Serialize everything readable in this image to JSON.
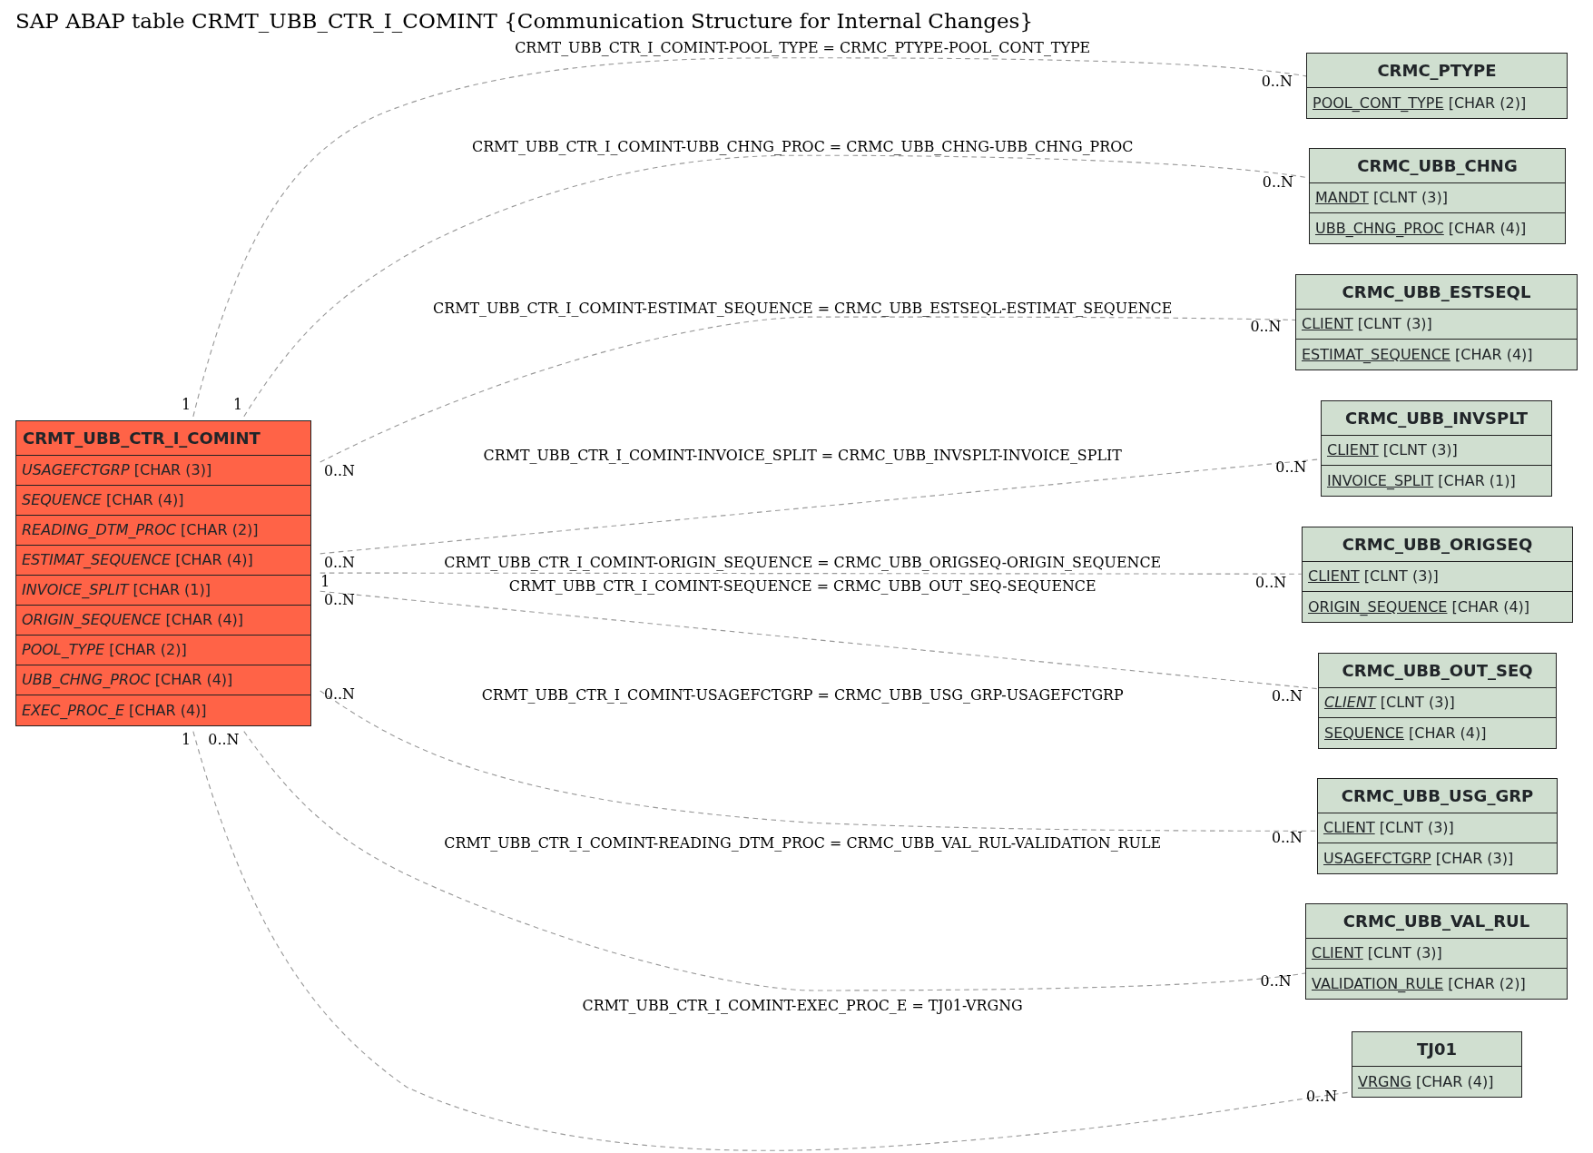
{
  "title": "SAP ABAP table CRMT_UBB_CTR_I_COMINT {Communication Structure for Internal Changes}",
  "main_table": {
    "name": "CRMT_UBB_CTR_I_COMINT",
    "fields": [
      {
        "name": "USAGEFCTGRP",
        "type": "[CHAR (3)]",
        "key": false,
        "italic": true
      },
      {
        "name": "SEQUENCE",
        "type": "[CHAR (4)]",
        "key": false,
        "italic": true
      },
      {
        "name": "READING_DTM_PROC",
        "type": "[CHAR (2)]",
        "key": false,
        "italic": true
      },
      {
        "name": "ESTIMAT_SEQUENCE",
        "type": "[CHAR (4)]",
        "key": false,
        "italic": true
      },
      {
        "name": "INVOICE_SPLIT",
        "type": "[CHAR (1)]",
        "key": false,
        "italic": true
      },
      {
        "name": "ORIGIN_SEQUENCE",
        "type": "[CHAR (4)]",
        "key": false,
        "italic": true
      },
      {
        "name": "POOL_TYPE",
        "type": "[CHAR (2)]",
        "key": false,
        "italic": true
      },
      {
        "name": "UBB_CHNG_PROC",
        "type": "[CHAR (4)]",
        "key": false,
        "italic": true
      },
      {
        "name": "EXEC_PROC_E",
        "type": "[CHAR (4)]",
        "key": false,
        "italic": true
      }
    ]
  },
  "related_tables": [
    {
      "name": "CRMC_PTYPE",
      "fields": [
        {
          "name": "POOL_CONT_TYPE",
          "type": "[CHAR (2)]",
          "key": true,
          "italic": false
        }
      ]
    },
    {
      "name": "CRMC_UBB_CHNG",
      "fields": [
        {
          "name": "MANDT",
          "type": "[CLNT (3)]",
          "key": true,
          "italic": false
        },
        {
          "name": "UBB_CHNG_PROC",
          "type": "[CHAR (4)]",
          "key": true,
          "italic": false
        }
      ]
    },
    {
      "name": "CRMC_UBB_ESTSEQL",
      "fields": [
        {
          "name": "CLIENT",
          "type": "[CLNT (3)]",
          "key": true,
          "italic": false
        },
        {
          "name": "ESTIMAT_SEQUENCE",
          "type": "[CHAR (4)]",
          "key": true,
          "italic": false
        }
      ]
    },
    {
      "name": "CRMC_UBB_INVSPLT",
      "fields": [
        {
          "name": "CLIENT",
          "type": "[CLNT (3)]",
          "key": true,
          "italic": false
        },
        {
          "name": "INVOICE_SPLIT",
          "type": "[CHAR (1)]",
          "key": true,
          "italic": false
        }
      ]
    },
    {
      "name": "CRMC_UBB_ORIGSEQ",
      "fields": [
        {
          "name": "CLIENT",
          "type": "[CLNT (3)]",
          "key": true,
          "italic": false
        },
        {
          "name": "ORIGIN_SEQUENCE",
          "type": "[CHAR (4)]",
          "key": true,
          "italic": false
        }
      ]
    },
    {
      "name": "CRMC_UBB_OUT_SEQ",
      "fields": [
        {
          "name": "CLIENT",
          "type": "[CLNT (3)]",
          "key": true,
          "italic": true
        },
        {
          "name": "SEQUENCE",
          "type": "[CHAR (4)]",
          "key": true,
          "italic": false
        }
      ]
    },
    {
      "name": "CRMC_UBB_USG_GRP",
      "fields": [
        {
          "name": "CLIENT",
          "type": "[CLNT (3)]",
          "key": true,
          "italic": false
        },
        {
          "name": "USAGEFCTGRP",
          "type": "[CHAR (3)]",
          "key": true,
          "italic": false
        }
      ]
    },
    {
      "name": "CRMC_UBB_VAL_RUL",
      "fields": [
        {
          "name": "CLIENT",
          "type": "[CLNT (3)]",
          "key": true,
          "italic": false
        },
        {
          "name": "VALIDATION_RULE",
          "type": "[CHAR (2)]",
          "key": true,
          "italic": false
        }
      ]
    },
    {
      "name": "TJ01",
      "fields": [
        {
          "name": "VRGNG",
          "type": "[CHAR (4)]",
          "key": true,
          "italic": false
        }
      ]
    }
  ],
  "relations": [
    {
      "label": "CRMT_UBB_CTR_I_COMINT-POOL_TYPE = CRMC_PTYPE-POOL_CONT_TYPE",
      "source_cardinality": "1",
      "target_cardinality": "0..N"
    },
    {
      "label": "CRMT_UBB_CTR_I_COMINT-UBB_CHNG_PROC = CRMC_UBB_CHNG-UBB_CHNG_PROC",
      "source_cardinality": "1",
      "target_cardinality": "0..N"
    },
    {
      "label": "CRMT_UBB_CTR_I_COMINT-ESTIMAT_SEQUENCE = CRMC_UBB_ESTSEQL-ESTIMAT_SEQUENCE",
      "source_cardinality": "0..N",
      "target_cardinality": "0..N"
    },
    {
      "label": "CRMT_UBB_CTR_I_COMINT-INVOICE_SPLIT = CRMC_UBB_INVSPLT-INVOICE_SPLIT",
      "source_cardinality": "0..N",
      "target_cardinality": "0..N"
    },
    {
      "label": "CRMT_UBB_CTR_I_COMINT-ORIGIN_SEQUENCE = CRMC_UBB_ORIGSEQ-ORIGIN_SEQUENCE",
      "source_cardinality": "1",
      "target_cardinality": "0..N"
    },
    {
      "label": "CRMT_UBB_CTR_I_COMINT-SEQUENCE = CRMC_UBB_OUT_SEQ-SEQUENCE",
      "source_cardinality": "0..N",
      "target_cardinality": "0..N"
    },
    {
      "label": "CRMT_UBB_CTR_I_COMINT-USAGEFCTGRP = CRMC_UBB_USG_GRP-USAGEFCTGRP",
      "source_cardinality": "0..N",
      "target_cardinality": "0..N"
    },
    {
      "label": "CRMT_UBB_CTR_I_COMINT-READING_DTM_PROC = CRMC_UBB_VAL_RUL-VALIDATION_RULE",
      "source_cardinality": "0..N",
      "target_cardinality": "0..N"
    },
    {
      "label": "CRMT_UBB_CTR_I_COMINT-EXEC_PROC_E = TJ01-VRGNG",
      "source_cardinality": "1",
      "target_cardinality": "0..N"
    }
  ]
}
